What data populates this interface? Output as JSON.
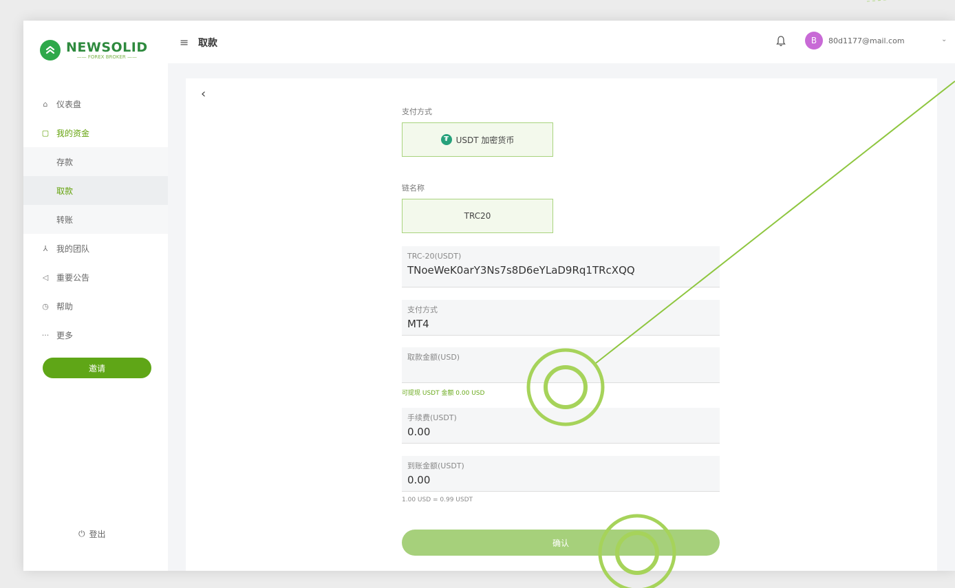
{
  "brand": {
    "name": "NEWSOLID",
    "tagline": "—— FOREX BROKER ——"
  },
  "header": {
    "title": "取款",
    "user_initial": "B",
    "user_email": "80d1177@mail.com"
  },
  "sidebar": {
    "items": [
      {
        "label": "仪表盘"
      },
      {
        "label": "我的资金"
      },
      {
        "label": "存款"
      },
      {
        "label": "取款"
      },
      {
        "label": "转账"
      },
      {
        "label": "我的团队"
      },
      {
        "label": "重要公告"
      },
      {
        "label": "帮助"
      },
      {
        "label": "更多"
      }
    ],
    "invite_label": "邀请",
    "logout_label": "登出"
  },
  "form": {
    "pay_method_label": "支付方式",
    "pay_method_value": "USDT 加密货币",
    "chain_label": "链名称",
    "chain_value": "TRC20",
    "address_label": "TRC-20(USDT)",
    "address_value": "TNoeWeK0arY3Ns7s8D6eYLaD9Rq1TRcXQQ",
    "account_label": "支付方式",
    "account_value": "MT4",
    "amount_label": "取款金额(USD)",
    "amount_value": "",
    "available_hint": "可提现 USDT 金额 0.00 USD",
    "fee_label": "手续费(USDT)",
    "fee_value": "0.00",
    "receive_label": "到账金额(USDT)",
    "receive_value": "0.00",
    "rate_hint": "1.00 USD = 0.99 USDT",
    "confirm_label": "确认"
  },
  "colors": {
    "accent": "#5fa617",
    "annotation": "#a6d35a"
  }
}
